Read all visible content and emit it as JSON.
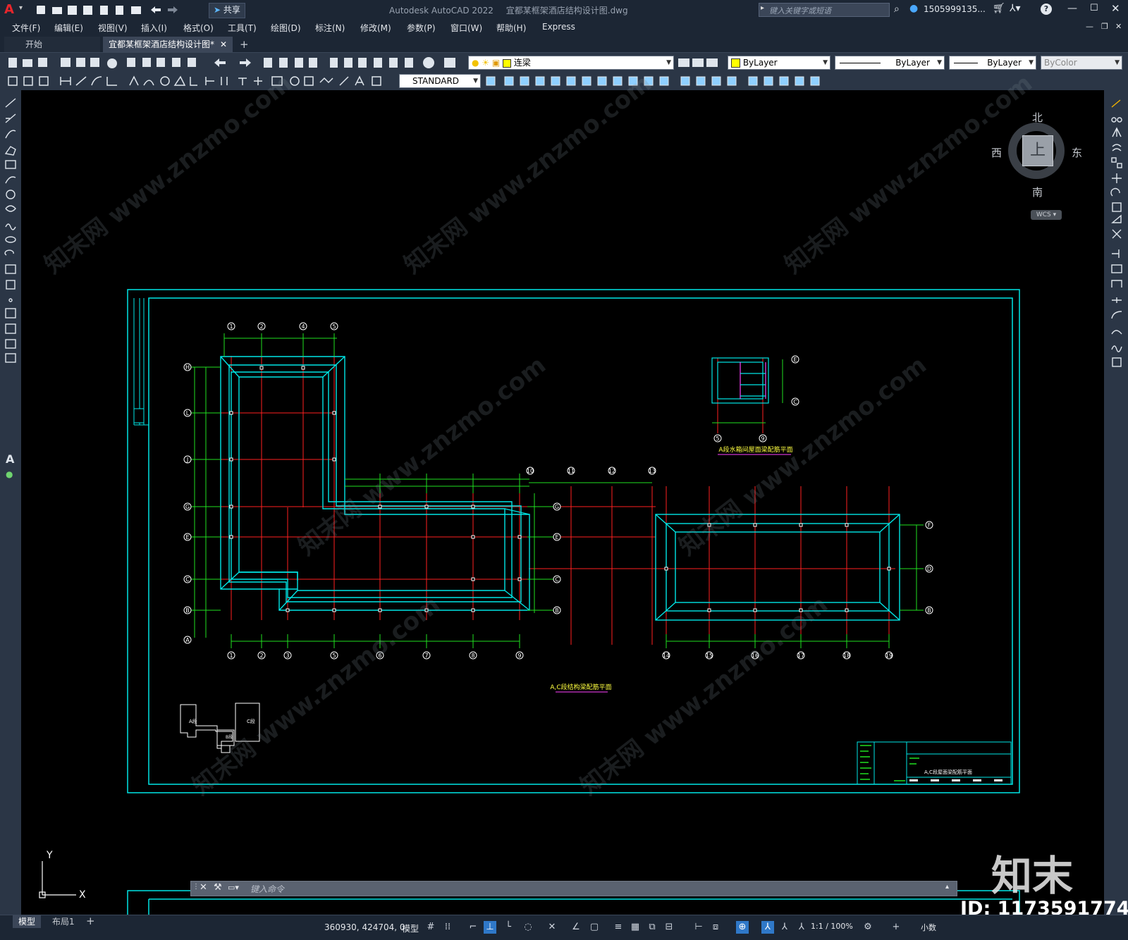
{
  "app": {
    "title": "Autodesk AutoCAD 2022",
    "document": "宜都某框架酒店结构设计图.dwg",
    "search_placeholder": "键入关键字或短语",
    "user": "1505999135...",
    "share": "共享"
  },
  "menu": [
    "文件(F)",
    "编辑(E)",
    "视图(V)",
    "插入(I)",
    "格式(O)",
    "工具(T)",
    "绘图(D)",
    "标注(N)",
    "修改(M)",
    "参数(P)",
    "窗口(W)",
    "帮助(H)",
    "Express"
  ],
  "tabs": [
    {
      "label": "开始"
    },
    {
      "label": "宜都某框架酒店结构设计图*",
      "active": true
    }
  ],
  "toolbar": {
    "layer": "连梁",
    "color": "ByLayer",
    "linetype": "ByLayer",
    "lineweight": "ByLayer",
    "plotstyle": "ByColor",
    "dimstyle": "STANDARD"
  },
  "viewcube": {
    "north": "北",
    "south": "南",
    "east": "东",
    "west": "西",
    "top": "上",
    "wcs": "WCS"
  },
  "drawing": {
    "plan_title_main": "A,C段结构梁配筋平面",
    "plan_title_small": "A段水箱间屋面梁配筋平面",
    "title_block_text": "A,C段屋面梁配筋平面",
    "key_plan": {
      "a": "A段",
      "b": "B段",
      "c": "C段"
    },
    "axes_top_left": [
      "1",
      "2",
      "4",
      "5"
    ],
    "axes_bottom_left": [
      "1",
      "2",
      "3",
      "5",
      "6",
      "7",
      "8",
      "9"
    ],
    "axes_top_mid": [
      "10",
      "11",
      "12",
      "13"
    ],
    "axes_bottom_right": [
      "14",
      "15",
      "16",
      "17",
      "18",
      "19"
    ],
    "axes_rows_left": [
      "H",
      "L",
      "J",
      "G",
      "E",
      "C",
      "B",
      "A"
    ],
    "axes_rows_mid": [
      "G",
      "E",
      "C",
      "B"
    ],
    "axes_rows_right": [
      "F",
      "D",
      "B"
    ],
    "axes_small": [
      "E",
      "C",
      "5",
      "9"
    ]
  },
  "command": {
    "placeholder": "键入命令"
  },
  "status": {
    "model_tab": "模型",
    "layout_tab": "布局1",
    "coords": "360930, 424704, 0",
    "space": "模型",
    "scale": "1:1 / 100%",
    "units": "小数"
  },
  "watermarks": {
    "brand": "知末",
    "id_text": "ID: 1173591774",
    "site": "www.znzmo.com",
    "cn_site": "知末网"
  },
  "colors": {
    "accent": "#00e6e6",
    "red": "#ff2020",
    "green": "#20e020",
    "white": "#ffffff",
    "chrome": "#2b3646"
  }
}
